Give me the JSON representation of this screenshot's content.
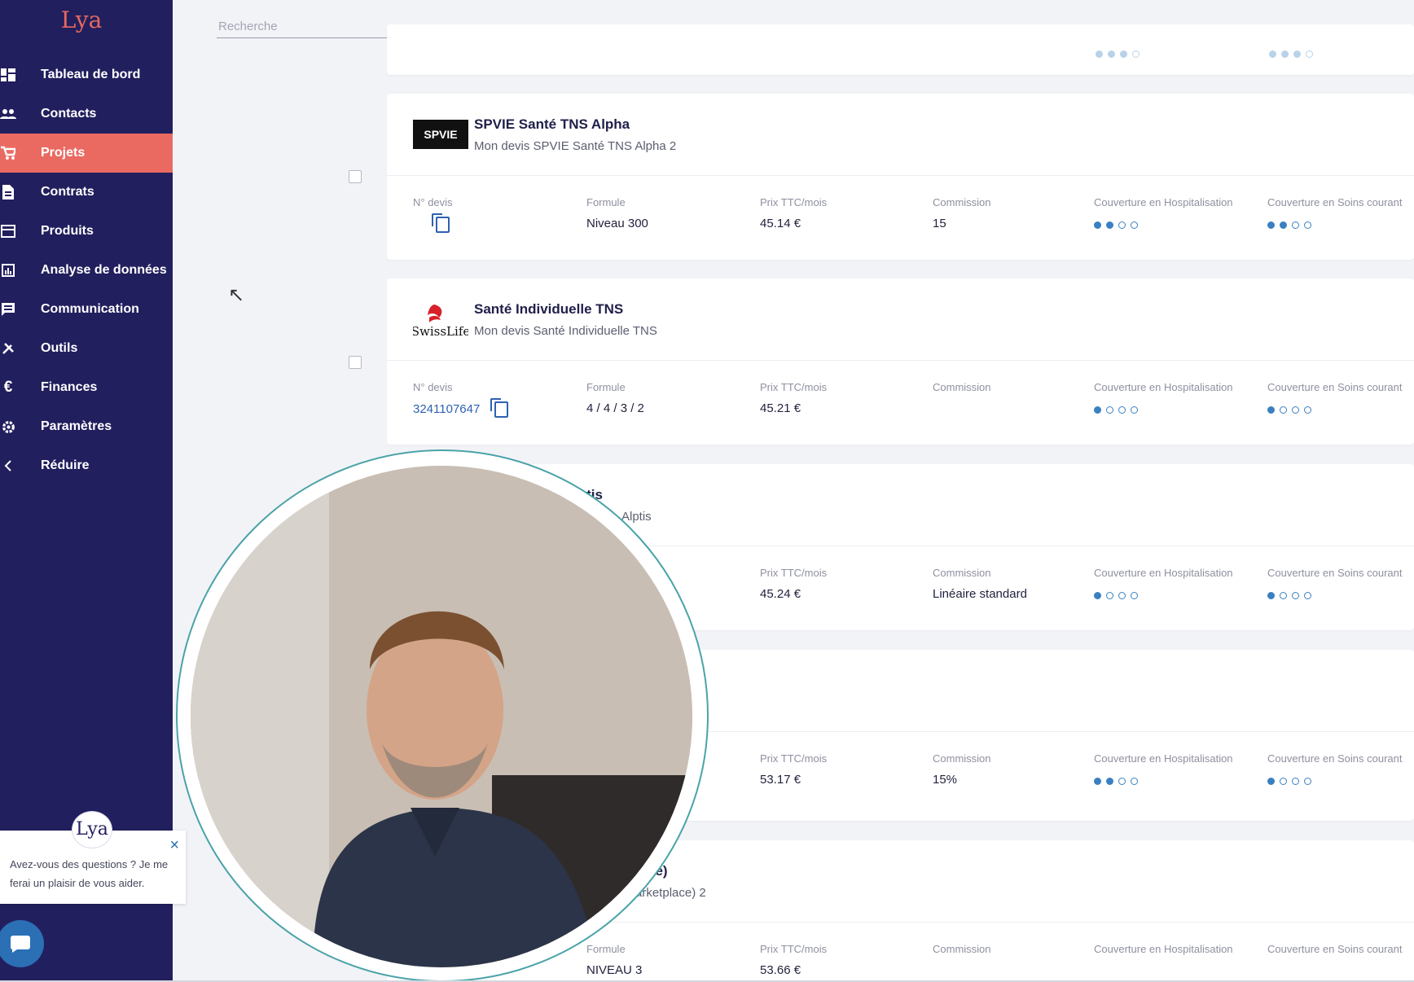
{
  "app": {
    "logo_text": "Lya"
  },
  "search": {
    "placeholder": "Recherche"
  },
  "sidebar": {
    "items": [
      {
        "label": "Tableau de bord",
        "icon": "dashboard-icon"
      },
      {
        "label": "Contacts",
        "icon": "contacts-icon"
      },
      {
        "label": "Projets",
        "icon": "cart-icon",
        "active": true
      },
      {
        "label": "Contrats",
        "icon": "document-icon"
      },
      {
        "label": "Produits",
        "icon": "products-icon"
      },
      {
        "label": "Analyse de données",
        "icon": "analytics-icon"
      },
      {
        "label": "Communication",
        "icon": "message-icon"
      },
      {
        "label": "Outils",
        "icon": "tools-icon"
      },
      {
        "label": "Finances",
        "icon": "euro-icon"
      },
      {
        "label": "Paramètres",
        "icon": "gear-icon"
      },
      {
        "label": "Réduire",
        "icon": "chevron-left-icon"
      }
    ]
  },
  "chat": {
    "logo_text": "Lya",
    "message": "Avez-vous des questions ? Je me ferai un plaisir de vous aider."
  },
  "labels": {
    "quote_no": "N° devis",
    "formula": "Formule",
    "price": "Prix TTC/mois",
    "commission": "Commission",
    "hosp": "Couverture en Hospitalisation",
    "care": "Couverture en Soins courant"
  },
  "cards": [
    {
      "title": "SPVIE Santé TNS Alpha",
      "subtitle": "Mon devis SPVIE Santé TNS Alpha 2",
      "logo_text": "SPVIE",
      "quote_no": "",
      "formula": "Niveau 300",
      "price": "45.14 €",
      "commission": "15",
      "hosp_level": 2,
      "care_level": 2
    },
    {
      "title": "Santé Individuelle TNS",
      "subtitle": "Mon devis Santé Individuelle TNS",
      "logo_text": "SwissLife",
      "quote_no": "3241107647",
      "formula": "4 / 4 / 3 / 2",
      "price": "45.21 €",
      "commission": "",
      "hosp_level": 1,
      "care_level": 1
    },
    {
      "title": "lotis",
      "subtitle": "Alptis",
      "price": "45.24 €",
      "commission": "Linéaire standard",
      "hosp_level": 1,
      "care_level": 1
    },
    {
      "price": "53.17 €",
      "commission": "15%",
      "hosp_level": 2,
      "care_level": 1
    },
    {
      "title": "ce)",
      "subtitle": "arketplace) 2",
      "formula": "NIVEAU 3",
      "price": "53.66 €"
    }
  ]
}
